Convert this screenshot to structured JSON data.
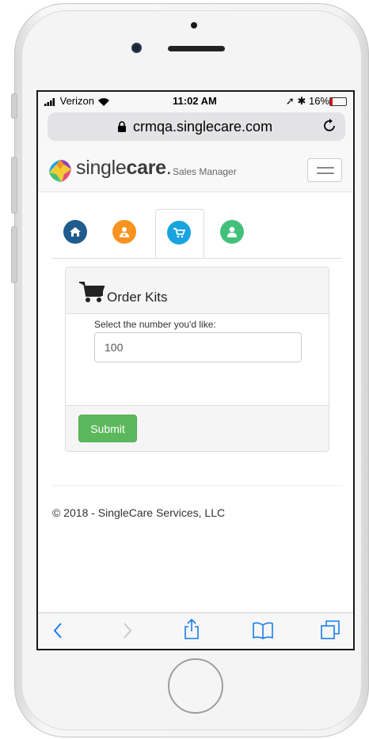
{
  "status_bar": {
    "carrier": "Verizon",
    "time": "11:02 AM",
    "battery": "16%",
    "battery_level": 0.16
  },
  "browser": {
    "url": "crmqa.singlecare.com"
  },
  "app": {
    "brand_light": "single",
    "brand_bold": "care",
    "brand_dot": ".",
    "subtitle": "Sales Manager"
  },
  "tabs": [
    {
      "name": "home",
      "icon": "home-icon",
      "color": "#1f5c8e"
    },
    {
      "name": "doctor",
      "icon": "doctor-icon",
      "color": "#f7931e"
    },
    {
      "name": "order",
      "icon": "cart-icon",
      "color": "#19a4e0",
      "active": true
    },
    {
      "name": "user",
      "icon": "user-icon",
      "color": "#45c07a"
    }
  ],
  "panel": {
    "title": "Order Kits",
    "field_label": "Select the number you'd like:",
    "field_value": "100",
    "submit_label": "Submit",
    "submit_color": "#5cb85c"
  },
  "footer": {
    "copyright": "© 2018 - SingleCare Services, LLC"
  },
  "toolbar": [
    "back-icon",
    "forward-icon",
    "share-icon",
    "bookmarks-icon",
    "tabs-icon"
  ]
}
